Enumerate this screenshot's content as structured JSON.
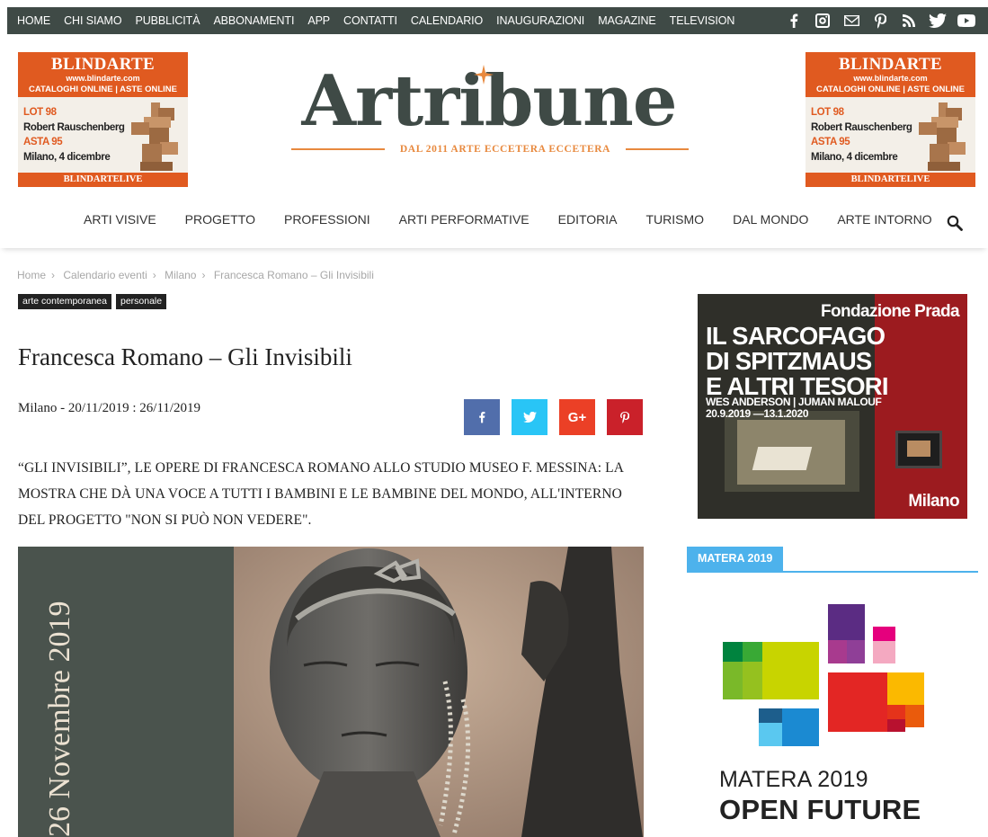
{
  "topnav": [
    "HOME",
    "CHI SIAMO",
    "PUBBLICITÀ",
    "ABBONAMENTI",
    "APP",
    "CONTATTI",
    "CALENDARIO",
    "INAUGURAZIONI",
    "MAGAZINE",
    "TELEVISION"
  ],
  "social_icons": [
    "facebook-icon",
    "instagram-icon",
    "mail-icon",
    "pinterest-icon",
    "rss-icon",
    "twitter-icon",
    "youtube-icon"
  ],
  "ad": {
    "brand": "BLINDARTE",
    "url": "www.blindarte.com",
    "sub": "CATALOGHI ONLINE | ASTE ONLINE",
    "lot": "LOT 98",
    "artist": "Robert Rauschenberg",
    "asta": "ASTA 95",
    "place": "Milano, 4 dicembre",
    "footer": "BLINDARTELIVE"
  },
  "logo": {
    "name": "Artribune",
    "tagline": "DAL 2011 ARTE ECCETERA ECCETERA"
  },
  "mainnav": [
    "ARTI VISIVE",
    "PROGETTO",
    "PROFESSIONI",
    "ARTI PERFORMATIVE",
    "EDITORIA",
    "TURISMO",
    "DAL MONDO",
    "ARTE INTORNO"
  ],
  "breadcrumb": [
    "Home",
    "Calendario eventi",
    "Milano",
    "Francesca Romano – Gli Invisibili"
  ],
  "tags": [
    "arte contemporanea",
    "personale"
  ],
  "article": {
    "title": "Francesca Romano – Gli Invisibili",
    "meta": "Milano - 20/11/2019 : 26/11/2019",
    "lead": "“GLI INVISIBILI”, LE OPERE DI FRANCESCA ROMANO ALLO STUDIO MUSEO F. MESSINA: LA MOSTRA CHE DÀ UNA VOCE A TUTTI I BAMBINI E LE BAMBINE DEL MONDO, ALL'INTERNO DEL PROGETTO \"NON SI PUÒ NON VEDERE\".",
    "image_date": "26 Novembre 2019"
  },
  "share": {
    "facebook": "f",
    "twitter": "t",
    "googleplus": "G+",
    "pinterest": "p"
  },
  "prada_ad": {
    "brand": "Fondazione Prada",
    "title_lines": [
      "IL SARCOFAGO",
      "DI SPITZMAUS",
      "E ALTRI TESORI"
    ],
    "authors": "WES ANDERSON | JUMAN MALOUF",
    "dates": "20.9.2019 —13.1.2020",
    "city": "Milano"
  },
  "sidebar": {
    "section_title": "MATERA 2019",
    "matera_line1": "MATERA 2019",
    "matera_line2": "OPEN FUTURE"
  },
  "colors": {
    "topbar": "#3f4a46",
    "ad_orange": "#e05a20",
    "accent_blue": "#4db2ec",
    "facebook": "#516eab",
    "twitter": "#29c5f6",
    "googleplus": "#eb4026",
    "pinterest": "#ca212a"
  }
}
